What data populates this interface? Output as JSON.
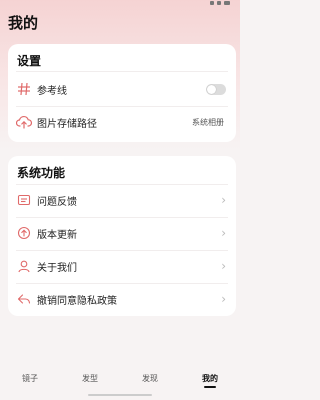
{
  "colors": {
    "accent": "#f07070",
    "icon": "#e06a6a"
  },
  "page": {
    "title": "我的"
  },
  "settings": {
    "title": "设置",
    "items": [
      {
        "icon": "hash-icon",
        "label": "参考线",
        "control": "toggle",
        "toggle_on": false
      },
      {
        "icon": "cloud-upload-icon",
        "label": "图片存储路径",
        "value": "系统相册"
      }
    ]
  },
  "functions": {
    "title": "系统功能",
    "items": [
      {
        "icon": "feedback-icon",
        "label": "问题反馈"
      },
      {
        "icon": "update-icon",
        "label": "版本更新"
      },
      {
        "icon": "user-icon",
        "label": "关于我们"
      },
      {
        "icon": "revoke-icon",
        "label": "撤销同意隐私政策"
      }
    ]
  },
  "tabs": [
    {
      "label": "镜子",
      "active": false
    },
    {
      "label": "发型",
      "active": false
    },
    {
      "label": "发现",
      "active": false
    },
    {
      "label": "我的",
      "active": true
    }
  ]
}
